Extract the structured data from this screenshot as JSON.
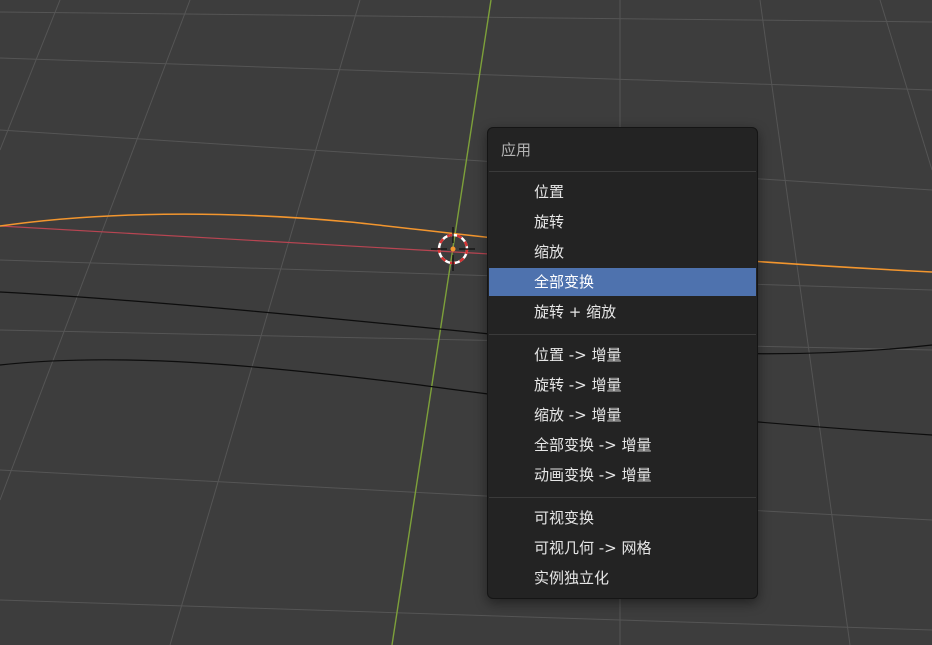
{
  "viewport": {
    "colors": {
      "background": "#3d3d3d",
      "grid": "#555555",
      "y_axis": "#7da03a",
      "x_axis": "#b84552",
      "selected_curve": "#f3962e",
      "curve": "#0d0d0d"
    },
    "cursor_icon": "3d-cursor-icon"
  },
  "menu": {
    "title": "应用",
    "items": [
      {
        "label": "位置"
      },
      {
        "label": "旋转"
      },
      {
        "label": "缩放"
      },
      {
        "label": "全部变换",
        "highlighted": true
      },
      {
        "label": "旋转 + 缩放"
      },
      {
        "label": "位置 -> 增量"
      },
      {
        "label": "旋转 -> 增量"
      },
      {
        "label": "缩放 -> 增量"
      },
      {
        "label": "全部变换 -> 增量"
      },
      {
        "label": "动画变换 -> 增量"
      },
      {
        "label": "可视变换"
      },
      {
        "label": "可视几何 -> 网格"
      },
      {
        "label": "实例独立化"
      }
    ],
    "colors": {
      "background": "#232323",
      "highlight": "#4e72ae",
      "text": "#e6e6e6",
      "title_text": "#b3b3b3"
    }
  }
}
